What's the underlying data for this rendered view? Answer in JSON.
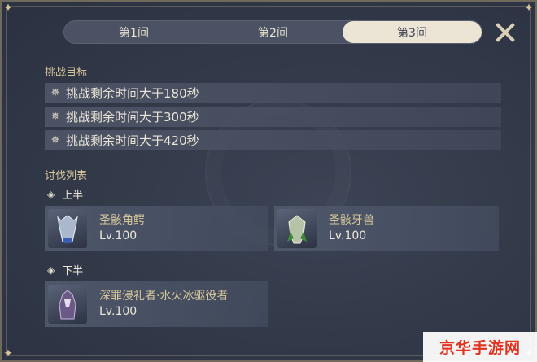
{
  "tabs": [
    {
      "label": "第1间",
      "active": false
    },
    {
      "label": "第2间",
      "active": false
    },
    {
      "label": "第3间",
      "active": true
    }
  ],
  "close_icon": "close-x-icon",
  "challenge": {
    "title": "挑战目标",
    "goals": [
      "挑战剩余时间大于180秒",
      "挑战剩余时间大于300秒",
      "挑战剩余时间大于420秒"
    ]
  },
  "enemies": {
    "title": "讨伐列表",
    "first_half": {
      "label": "上半",
      "list": [
        {
          "name": "圣骸角鳄",
          "level": "Lv.100",
          "icon": "horned-croc-portrait"
        },
        {
          "name": "圣骸牙兽",
          "level": "Lv.100",
          "icon": "fang-beast-portrait"
        }
      ]
    },
    "second_half": {
      "label": "下半",
      "list": [
        {
          "name": "深罪浸礼者·水火冰驱役者",
          "level": "Lv.100",
          "icon": "sinner-portrait"
        }
      ]
    }
  },
  "watermark": "京华手游网",
  "colors": {
    "panel": "#343b4b",
    "row": "#4e5668",
    "accent_gold": "#d6c79b",
    "tab_active": "#ece5d6",
    "watermark_red": "#e0321e"
  }
}
